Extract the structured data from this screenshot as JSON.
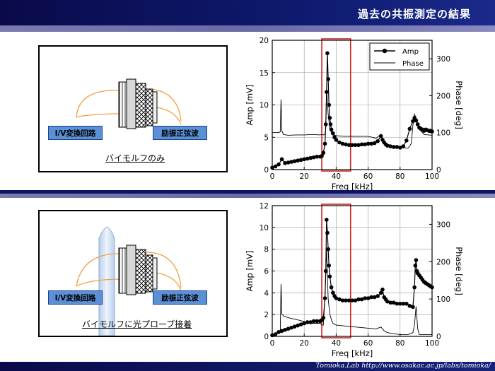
{
  "header": {
    "title": "過去の共振測定の結果"
  },
  "footer": {
    "text": "Tomioka.Lab   http://www.osakac.ac.jp/labs/tomioka/"
  },
  "panel_top": {
    "left_label": "I/V変換回路",
    "right_label": "励振正弦波",
    "caption": "バイモルフのみ"
  },
  "panel_bottom": {
    "left_label": "I/V変換回路",
    "right_label": "励振正弦波",
    "caption": "バイモルフに光プローブ接着"
  },
  "colors": {
    "highlight_box": "#cc2222",
    "label_fill": "#5b8fd6",
    "wire": "#f0a040",
    "probe": "#cfe0f5"
  },
  "chart_data": [
    {
      "type": "line",
      "xlabel": "Freq [kHz]",
      "ylabel": "Amp [mV]",
      "y2label": "Phase [deg]",
      "xlim": [
        0,
        100
      ],
      "ylim": [
        0,
        20
      ],
      "y2lim": [
        0,
        350
      ],
      "xticks": [
        0,
        20,
        40,
        60,
        80,
        100
      ],
      "yticks": [
        0,
        5,
        10,
        15,
        20
      ],
      "y2ticks": [
        0,
        100,
        200,
        300
      ],
      "legend": {
        "position": "top-right",
        "entries": [
          "Amp",
          "Phase"
        ]
      },
      "highlight_range": [
        31,
        49
      ],
      "series": [
        {
          "name": "Amp",
          "x": [
            0,
            2,
            4,
            6,
            8,
            10,
            12,
            14,
            16,
            18,
            20,
            22,
            24,
            26,
            28,
            30,
            31,
            32,
            33,
            33.5,
            34,
            34.5,
            35,
            35.5,
            36,
            36.5,
            37,
            38,
            39,
            40,
            42,
            44,
            46,
            48,
            50,
            52,
            54,
            56,
            58,
            60,
            62,
            64,
            66,
            68,
            69,
            70,
            71,
            72,
            74,
            76,
            78,
            80,
            82,
            84,
            86,
            88,
            89,
            90,
            91,
            92,
            93,
            94,
            95,
            96,
            97,
            98,
            99,
            100
          ],
          "y": [
            0.3,
            0.5,
            0.8,
            1.6,
            1.0,
            1.1,
            1.2,
            1.3,
            1.4,
            1.5,
            1.6,
            1.7,
            1.8,
            1.9,
            2.0,
            2.0,
            2.1,
            2.6,
            4.0,
            7.0,
            12.0,
            18.0,
            14.0,
            10.0,
            8.0,
            7.0,
            6.2,
            5.6,
            5.0,
            4.6,
            4.2,
            4.0,
            3.9,
            3.8,
            3.8,
            3.8,
            3.8,
            3.9,
            3.9,
            4.0,
            4.0,
            4.1,
            4.4,
            5.2,
            4.6,
            4.2,
            3.9,
            3.7,
            3.6,
            3.5,
            3.5,
            3.4,
            3.6,
            4.5,
            6.3,
            7.5,
            8.0,
            7.6,
            7.0,
            6.5,
            6.3,
            6.2,
            6.0,
            6.2,
            6.1,
            6.0,
            6.0,
            5.9
          ]
        },
        {
          "name": "Phase",
          "x": [
            0,
            2,
            4,
            5,
            5.5,
            6,
            7,
            10,
            15,
            20,
            25,
            30,
            31,
            32,
            33,
            33.5,
            34,
            35,
            36,
            37,
            38,
            40,
            45,
            50,
            55,
            60,
            65,
            68,
            69,
            70,
            72,
            75,
            80,
            85,
            87,
            88,
            89,
            90,
            92,
            95,
            100
          ],
          "y": [
            100,
            100,
            100,
            102,
            190,
            105,
            95,
            93,
            94,
            94,
            95,
            94,
            95,
            94,
            96,
            110,
            220,
            150,
            110,
            100,
            94,
            92,
            90,
            90,
            90,
            90,
            85,
            95,
            85,
            75,
            70,
            63,
            60,
            58,
            70,
            120,
            150,
            140,
            110,
            95,
            93
          ]
        }
      ]
    },
    {
      "type": "line",
      "xlabel": "Freq [kHz]",
      "ylabel": "Amp [mV]",
      "y2label": "Phase [deg]",
      "xlim": [
        0,
        100
      ],
      "ylim": [
        0,
        12
      ],
      "y2lim": [
        0,
        350
      ],
      "xticks": [
        0,
        20,
        40,
        60,
        80,
        100
      ],
      "yticks": [
        0,
        2,
        4,
        6,
        8,
        10,
        12
      ],
      "y2ticks": [
        0,
        100,
        200,
        300
      ],
      "highlight_range": [
        31,
        49
      ],
      "series": [
        {
          "name": "Amp",
          "x": [
            0,
            2,
            4,
            6,
            8,
            10,
            12,
            14,
            16,
            18,
            20,
            22,
            24,
            26,
            28,
            30,
            31,
            32,
            33,
            33.5,
            34,
            34.5,
            35,
            35.5,
            36,
            37,
            38,
            39,
            40,
            42,
            44,
            46,
            48,
            50,
            52,
            54,
            56,
            58,
            60,
            62,
            64,
            66,
            68,
            69,
            70,
            71,
            72,
            74,
            76,
            78,
            80,
            82,
            84,
            86,
            88,
            89,
            89.5,
            90,
            90.5,
            91,
            92,
            93,
            94,
            95,
            96,
            97,
            98,
            99,
            100
          ],
          "y": [
            0.1,
            0.2,
            0.4,
            0.5,
            0.6,
            0.7,
            0.8,
            0.9,
            1.0,
            1.1,
            1.2,
            1.3,
            1.3,
            1.4,
            1.4,
            1.4,
            1.5,
            1.7,
            3.5,
            6.0,
            10.7,
            9.5,
            8.0,
            6.5,
            5.5,
            4.5,
            4.0,
            3.7,
            3.5,
            3.4,
            3.3,
            3.3,
            3.3,
            3.3,
            3.3,
            3.4,
            3.4,
            3.5,
            3.5,
            3.6,
            3.6,
            3.7,
            4.0,
            4.3,
            3.6,
            3.4,
            3.2,
            3.1,
            3.1,
            3.0,
            3.0,
            3.0,
            3.0,
            2.8,
            2.7,
            4.5,
            6.5,
            7.0,
            6.0,
            5.8,
            5.6,
            5.4,
            5.2,
            5.0,
            4.9,
            4.8,
            4.7,
            4.6,
            4.5
          ]
        },
        {
          "name": "Phase",
          "x": [
            0,
            2,
            4,
            5,
            5.5,
            6,
            7,
            10,
            15,
            20,
            25,
            30,
            31,
            32,
            33,
            34,
            35,
            36,
            37,
            38,
            40,
            45,
            50,
            55,
            60,
            65,
            68,
            70,
            72,
            75,
            80,
            85,
            88,
            89,
            90,
            91,
            92,
            95,
            100
          ],
          "y": [
            5,
            5,
            10,
            10,
            140,
            60,
            55,
            50,
            45,
            40,
            35,
            35,
            30,
            30,
            110,
            230,
            100,
            60,
            45,
            35,
            30,
            28,
            26,
            24,
            22,
            20,
            25,
            15,
            10,
            8,
            5,
            5,
            10,
            30,
            80,
            20,
            5,
            5,
            5
          ]
        }
      ]
    }
  ]
}
